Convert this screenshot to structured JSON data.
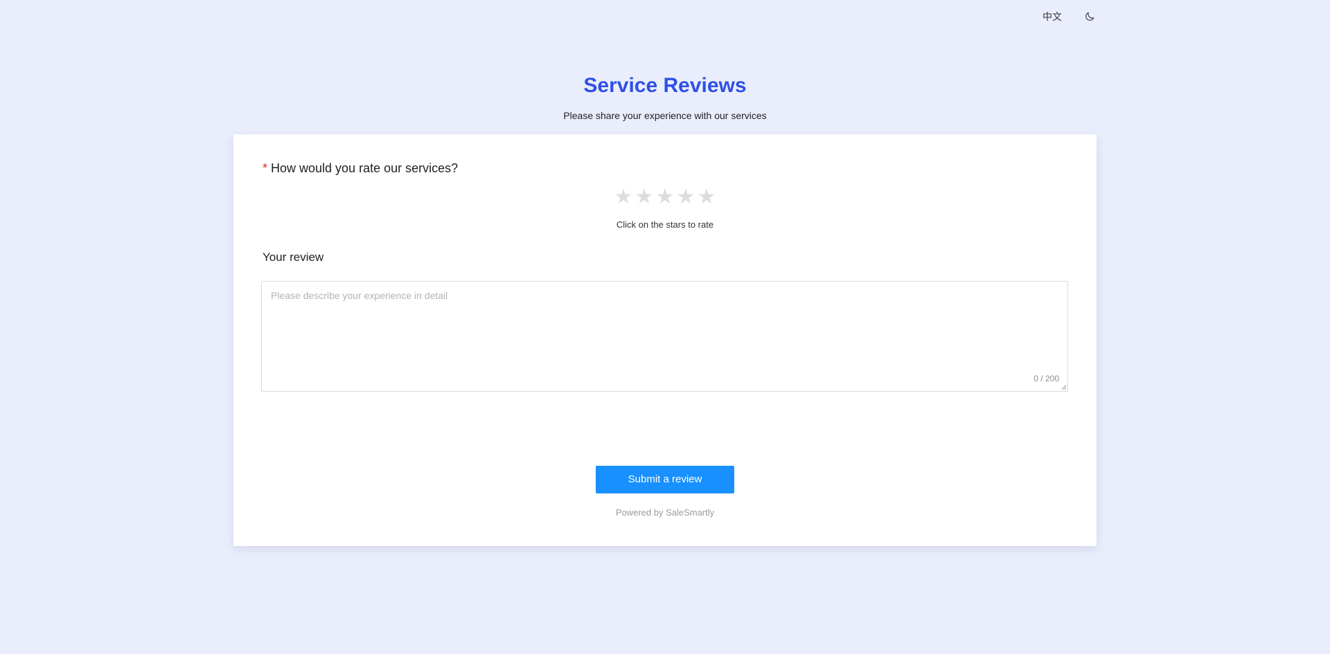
{
  "topbar": {
    "language_label": "中文",
    "theme_icon": "moon-icon"
  },
  "header": {
    "title": "Service Reviews",
    "subtitle": "Please share your experience with our services"
  },
  "rating": {
    "required_marker": "*",
    "question": "How would you rate our services?",
    "star_glyph": "★",
    "max_stars": 5,
    "current_rating": 0,
    "hint": "Click on the stars to rate"
  },
  "review": {
    "label": "Your review",
    "placeholder": "Please describe your experience in detail",
    "value": "",
    "char_count": "0 / 200"
  },
  "actions": {
    "submit_label": "Submit a review"
  },
  "footer": {
    "powered_by": "Powered by SaleSmartly"
  },
  "colors": {
    "page_background": "#eaeefc",
    "title": "#2e50e6",
    "primary_button": "#1890ff",
    "required": "#e0282e",
    "star_empty": "#dddddd"
  }
}
